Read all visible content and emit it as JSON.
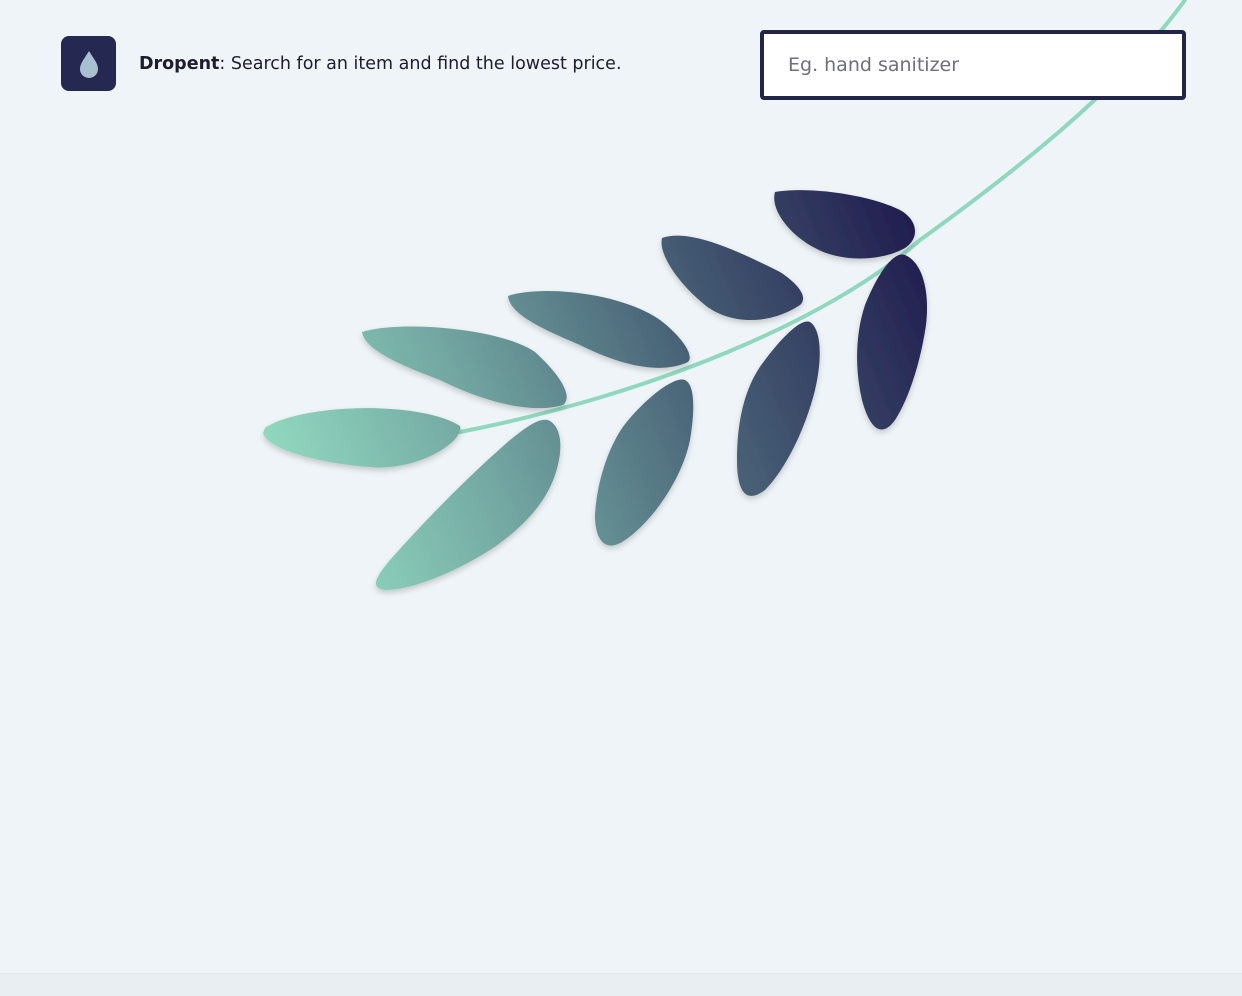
{
  "app": {
    "brand": "Dropent",
    "tagline": ": Search for an item and find the lowest price."
  },
  "search": {
    "placeholder": "Eg. hand sanitizer",
    "value": ""
  },
  "icons": {
    "logo": "water-drop-icon"
  },
  "colors": {
    "background": "#eef4f7",
    "brand_dark": "#252850",
    "accent_mint": "#8fd8be",
    "drop": "#a9c0d1"
  }
}
